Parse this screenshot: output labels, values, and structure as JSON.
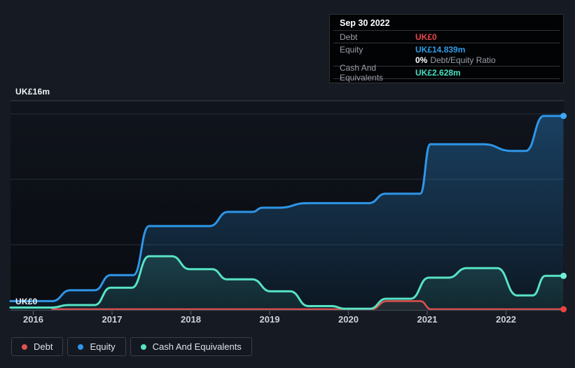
{
  "colors": {
    "page_bg": "#151a23",
    "plot_bg_top": "#10141c",
    "plot_bg_bottom": "#090c11",
    "grid": "#272e3a",
    "grid_bright": "#3a424e",
    "axis": "#3f4650",
    "tick": "#565d68",
    "year_label": "#ced3da",
    "tooltip_bg": "#020305",
    "tooltip_border": "#2e3238",
    "debt": "#e0514f",
    "equity": "#2e96e8",
    "cash": "#57e3c4"
  },
  "tooltip": {
    "date": "Sep 30 2022",
    "debt_label": "Debt",
    "debt_value": "UK£0",
    "equity_label": "Equity",
    "equity_value": "UK£14.839m",
    "ratio_value": "0%",
    "ratio_label": "Debt/Equity Ratio",
    "cash_label": "Cash And Equivalents",
    "cash_value": "UK£2.628m"
  },
  "legend": {
    "items": [
      {
        "label": "Debt"
      },
      {
        "label": "Equity"
      },
      {
        "label": "Cash And Equivalents"
      }
    ]
  },
  "chart_data": {
    "type": "area",
    "x_unit": "year",
    "x_ticks": [
      2016,
      2017,
      2018,
      2019,
      2020,
      2021,
      2022
    ],
    "y_axis": {
      "min": 0,
      "max": 16,
      "unit": "UK£m",
      "top_label": "UK£16m",
      "bottom_label": "UK£0",
      "gridlines": [
        5,
        10,
        15,
        16
      ]
    },
    "series": [
      {
        "name": "Debt",
        "color": "#e0514f",
        "marker": "#e8443f",
        "points": [
          [
            2016.24,
            0
          ],
          [
            2020.29,
            0
          ],
          [
            2020.49,
            0.62
          ],
          [
            2020.91,
            0.62
          ],
          [
            2021.05,
            0
          ],
          [
            2022.73,
            0
          ]
        ]
      },
      {
        "name": "Equity",
        "color": "#2e96e8",
        "marker": "#3da7f5",
        "points": [
          [
            2015.71,
            0.7
          ],
          [
            2016.24,
            0.7
          ],
          [
            2016.47,
            1.53
          ],
          [
            2016.78,
            1.53
          ],
          [
            2016.98,
            2.68
          ],
          [
            2017.27,
            2.68
          ],
          [
            2017.47,
            6.43
          ],
          [
            2018.24,
            6.43
          ],
          [
            2018.47,
            7.51
          ],
          [
            2018.78,
            7.51
          ],
          [
            2018.91,
            7.83
          ],
          [
            2019.12,
            7.83
          ],
          [
            2019.47,
            8.18
          ],
          [
            2020.26,
            8.18
          ],
          [
            2020.47,
            8.9
          ],
          [
            2020.91,
            8.9
          ],
          [
            2021.04,
            12.68
          ],
          [
            2021.71,
            12.68
          ],
          [
            2022.07,
            12.17
          ],
          [
            2022.25,
            12.17
          ],
          [
            2022.48,
            14.839
          ],
          [
            2022.73,
            14.839
          ]
        ]
      },
      {
        "name": "Cash And Equivalents",
        "color": "#57e3c4",
        "marker": "#6feed4",
        "points": [
          [
            2015.71,
            0.21
          ],
          [
            2016.24,
            0.21
          ],
          [
            2016.44,
            0.4
          ],
          [
            2016.78,
            0.4
          ],
          [
            2016.98,
            1.72
          ],
          [
            2017.25,
            1.72
          ],
          [
            2017.47,
            4.13
          ],
          [
            2017.76,
            4.13
          ],
          [
            2017.98,
            3.14
          ],
          [
            2018.27,
            3.14
          ],
          [
            2018.46,
            2.36
          ],
          [
            2018.78,
            2.36
          ],
          [
            2019.01,
            1.45
          ],
          [
            2019.26,
            1.45
          ],
          [
            2019.49,
            0.32
          ],
          [
            2019.79,
            0.32
          ],
          [
            2019.95,
            0.12
          ],
          [
            2020.27,
            0.12
          ],
          [
            2020.48,
            0.88
          ],
          [
            2020.79,
            0.88
          ],
          [
            2021.02,
            2.49
          ],
          [
            2021.27,
            2.49
          ],
          [
            2021.5,
            3.22
          ],
          [
            2021.89,
            3.22
          ],
          [
            2022.14,
            1.14
          ],
          [
            2022.34,
            1.14
          ],
          [
            2022.5,
            2.628
          ],
          [
            2022.73,
            2.628
          ]
        ]
      }
    ],
    "end_values": {
      "Debt": "UK£0",
      "Equity": "UK£14.839m",
      "Cash And Equivalents": "UK£2.628m"
    }
  }
}
